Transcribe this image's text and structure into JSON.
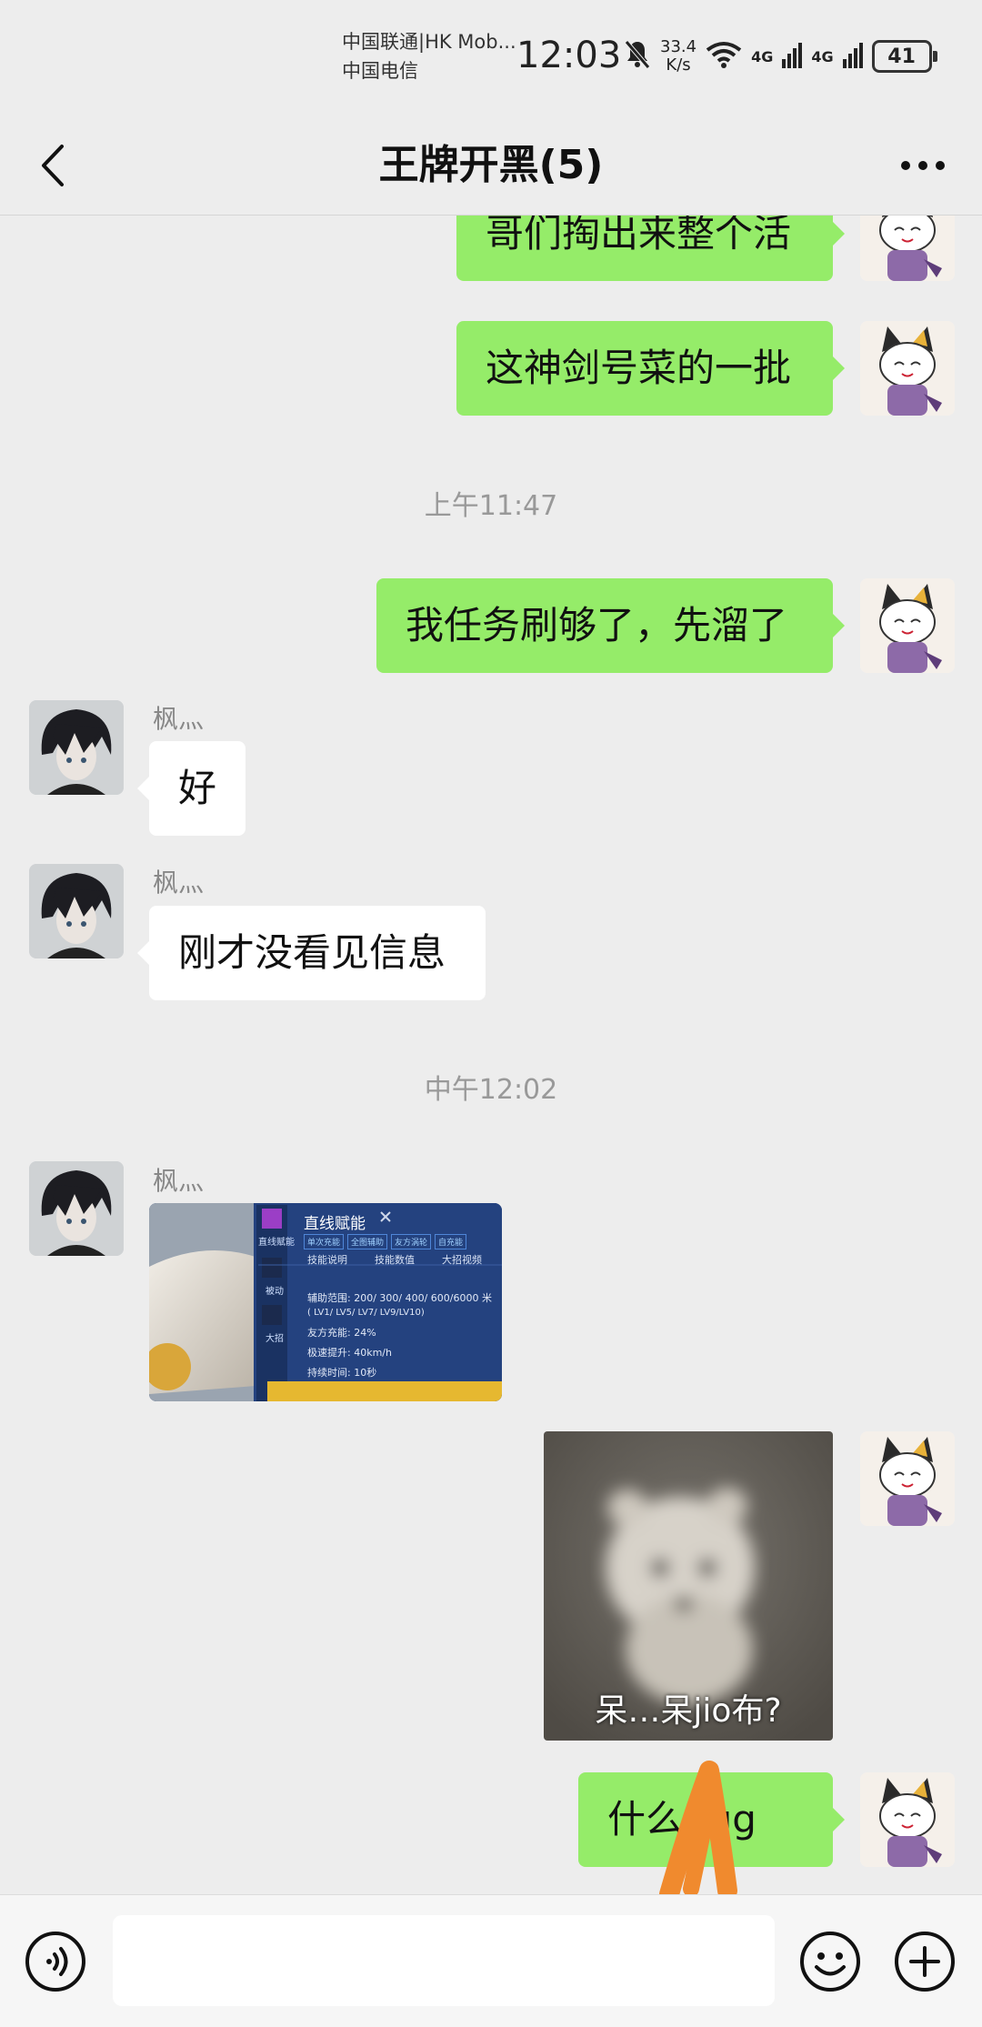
{
  "status_bar": {
    "carrier1": "中国联通|HK Mob...",
    "carrier2": "中国电信",
    "time": "12:03",
    "net_speed_value": "33.4",
    "net_speed_unit": "K/s",
    "signal_label": "4G",
    "battery": "41"
  },
  "header": {
    "title": "王牌开黑(5)"
  },
  "chat": {
    "messages": [
      {
        "text": "哥们掏出来整个活"
      },
      {
        "text": "这神剑号菜的一批"
      },
      {
        "text": "我任务刷够了，先溜了"
      },
      {
        "sender": "枫灬",
        "text": "好"
      },
      {
        "sender": "枫灬",
        "text": "刚才没看见信息"
      },
      {
        "sender": "枫灬"
      },
      {
        "caption": "呆…呆jio布?"
      },
      {
        "text": "什么bug"
      }
    ],
    "timestamps": [
      "上午11:47",
      "中午12:02"
    ],
    "game_card": {
      "title": "直线赋能",
      "tags": [
        "单次充能",
        "全图辅助",
        "友方涡轮",
        "自充能"
      ],
      "tabs": [
        "技能说明",
        "技能数值",
        "大招视频"
      ],
      "side_labels": [
        "直线赋能",
        "被动",
        "大招"
      ],
      "row1": "辅助范围: 200/ 300/ 400/ 600/6000 米",
      "row1b": "( LV1/ LV5/ LV7/ LV9/LV10)",
      "row2": "友方充能: 24%",
      "row3": "极速提升: 40km/h",
      "row4": "持续时间: 10秒"
    }
  },
  "colors": {
    "outgoing_bubble": "#95ec69",
    "incoming_bubble": "#ffffff",
    "background": "#ededed",
    "scribble": "#f08a2e"
  }
}
